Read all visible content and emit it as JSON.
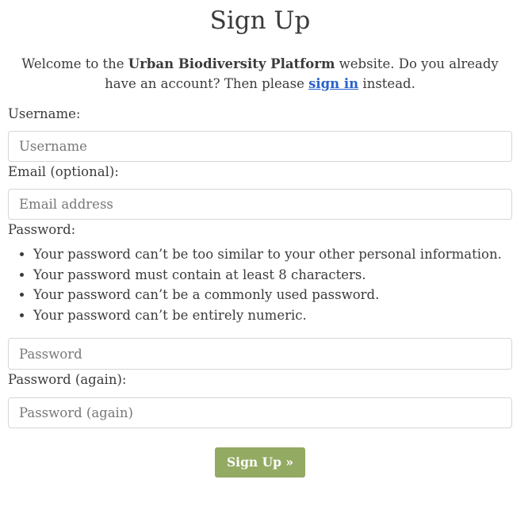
{
  "header": {
    "title": "Sign Up"
  },
  "intro": {
    "prefix": "Welcome to the ",
    "site_name": "Urban Biodiversity Platform",
    "middle": " website. Do you already have an account? Then please ",
    "link_text": "sign in",
    "suffix": " instead."
  },
  "form": {
    "username": {
      "label": "Username:",
      "placeholder": "Username",
      "value": ""
    },
    "email": {
      "label": "Email (optional):",
      "placeholder": "Email address",
      "value": ""
    },
    "password": {
      "label": "Password:",
      "help": [
        "Your password can’t be too similar to your other personal information.",
        "Your password must contain at least 8 characters.",
        "Your password can’t be a commonly used password.",
        "Your password can’t be entirely numeric."
      ],
      "placeholder": "Password",
      "value": ""
    },
    "password_again": {
      "label": "Password (again):",
      "placeholder": "Password (again)",
      "value": ""
    },
    "submit_label": "Sign Up »"
  },
  "colors": {
    "link": "#2a62c9",
    "button": "#93aa62",
    "text": "#3b3b3b",
    "border": "#d6d6d6"
  }
}
